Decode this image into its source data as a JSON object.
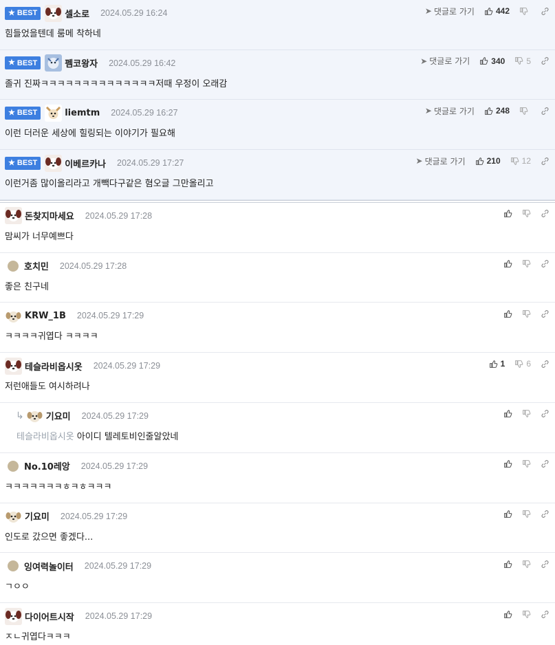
{
  "best_badge": "BEST",
  "goto_label": "댓글로 가기",
  "best_comments": [
    {
      "nick": "셀소로",
      "date": "2024.05.29 16:24",
      "text": "힘들었을텐데 룸메 착하네",
      "up": "442",
      "down": "",
      "avatar": "dog-avatar"
    },
    {
      "nick": "펨코왕자",
      "date": "2024.05.29 16:42",
      "text": "졸귀 진짜ㅋㅋㅋㅋㅋㅋㅋㅋㅋㅋㅋㅋㅋㅋ저때 우정이 오래감",
      "up": "340",
      "down": "5",
      "avatar": "blue-avatar"
    },
    {
      "nick": "liemtm",
      "date": "2024.05.29 16:27",
      "text": "이런 더러운 세상에 힐링되는 이야기가 필요해",
      "up": "248",
      "down": "",
      "avatar": "chihuahua-avatar"
    },
    {
      "nick": "이베르카나",
      "date": "2024.05.29 17:27",
      "text": "이런거좀 많이올리라고 개빽다구같은 혐오글 그만올리고",
      "up": "210",
      "down": "12",
      "avatar": "dog-avatar"
    }
  ],
  "comments": [
    {
      "nick": "돈찾지마세요",
      "date": "2024.05.29 17:28",
      "text": "맘씨가 너무예쁘다",
      "up": "",
      "down": "",
      "avatar": "dog-avatar",
      "reply": false,
      "mention": ""
    },
    {
      "nick": "호치민",
      "date": "2024.05.29 17:28",
      "text": "좋은 친구네",
      "up": "",
      "down": "",
      "avatar": "dot",
      "reply": false,
      "mention": ""
    },
    {
      "nick": "KRW_1B",
      "date": "2024.05.29 17:29",
      "text": "ㅋㅋㅋㅋ귀엽다 ㅋㅋㅋㅋ",
      "up": "",
      "down": "",
      "avatar": "puppy-avatar",
      "reply": false,
      "mention": ""
    },
    {
      "nick": "테슬라비옵시옷",
      "date": "2024.05.29 17:29",
      "text": "저런애들도 여시하려나",
      "up": "1",
      "down": "6",
      "avatar": "dog-avatar",
      "reply": false,
      "mention": ""
    },
    {
      "nick": "기요미",
      "date": "2024.05.29 17:29",
      "text": "아이디 텔레토비인줄알았네",
      "up": "",
      "down": "",
      "avatar": "puppy-avatar",
      "reply": true,
      "mention": "테슬라비옵시옷"
    },
    {
      "nick": "No.10레앙",
      "date": "2024.05.29 17:29",
      "text": "ㅋㅋㅋㅋㅋㅋㅋㅎㅋㅎㅋㅋㅋ",
      "up": "",
      "down": "",
      "avatar": "dot",
      "reply": false,
      "mention": ""
    },
    {
      "nick": "기요미",
      "date": "2024.05.29 17:29",
      "text": "인도로 갔으면 좋겠다...",
      "up": "",
      "down": "",
      "avatar": "puppy-avatar",
      "reply": false,
      "mention": ""
    },
    {
      "nick": "잉여력놀이터",
      "date": "2024.05.29 17:29",
      "text": "ㄱㅇㅇ",
      "up": "",
      "down": "",
      "avatar": "dot",
      "reply": false,
      "mention": ""
    },
    {
      "nick": "다이어트시작",
      "date": "2024.05.29 17:29",
      "text": "ㅈㄴ귀엽다ㅋㅋㅋ",
      "up": "",
      "down": "",
      "avatar": "dog-avatar",
      "reply": false,
      "mention": ""
    }
  ],
  "colors": {
    "badge": "#3d7fe0",
    "best_bg": "#f2f5fb",
    "date": "#8b8f96",
    "mention": "#9aa3ad"
  }
}
